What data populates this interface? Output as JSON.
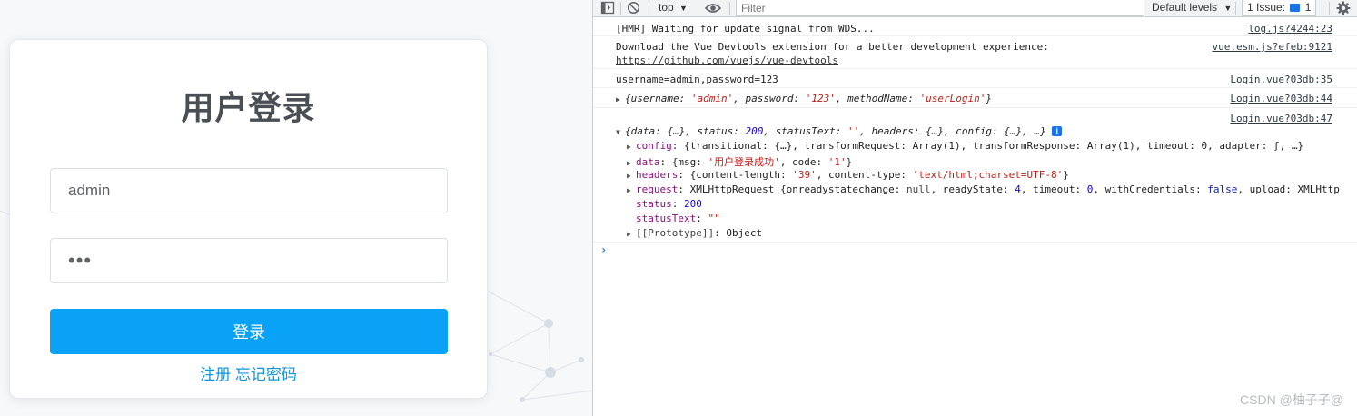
{
  "login": {
    "title": "用户登录",
    "username_value": "admin",
    "password_value": "•••",
    "submit_label": "登录",
    "register_link": "注册",
    "forgot_link": "忘记密码"
  },
  "devtools": {
    "toolbar": {
      "context": "top",
      "filter_placeholder": "Filter",
      "levels": "Default levels",
      "issues_label": "1 Issue:",
      "issues_count": "1"
    },
    "logs": [
      {
        "text": "[HMR] Waiting for update signal from WDS...",
        "source": "log.js?4244:23"
      },
      {
        "text": "Download the Vue Devtools extension for a better development experience:",
        "link": "https://github.com/vuejs/vue-devtools",
        "source": "vue.esm.js?efeb:9121"
      },
      {
        "text": "username=admin,password=123",
        "source": "Login.vue?03db:35"
      },
      {
        "source": "Login.vue?03db:44"
      },
      {
        "source": "Login.vue?03db:47"
      }
    ],
    "params_object": {
      "open": "{",
      "k1": "username",
      "v1": "'admin'",
      "k2": "password",
      "v2": "'123'",
      "k3": "methodName",
      "v3": "'userLogin'",
      "close": "}"
    },
    "response_summary": {
      "p1": "{data: {…}, status: ",
      "status": "200",
      "p2": ", statusText: ",
      "statusText": "''",
      "p3": ", headers: {…}, config: {…}, …}",
      "info": "i"
    },
    "response_props": {
      "config_key": "config",
      "config_val": "{transitional: {…}, transformRequest: Array(1), transformResponse: Array(1), timeout: 0, adapter: ƒ, …}",
      "data_key": "data",
      "data_p1": "{msg: ",
      "data_msg": "'用户登录成功'",
      "data_p2": ", code: ",
      "data_code": "'1'",
      "data_p3": "}",
      "headers_key": "headers",
      "headers_p1": "{content-length: ",
      "headers_len": "'39'",
      "headers_p2": ", content-type: ",
      "headers_type": "'text/html;charset=UTF-8'",
      "headers_p3": "}",
      "request_key": "request",
      "request_p1": "XMLHttpRequest {onreadystatechange: ",
      "request_null": "null",
      "request_p2": ", readyState: ",
      "request_rs": "4",
      "request_p3": ", timeout: ",
      "request_to": "0",
      "request_p4": ", withCredentials: ",
      "request_wc": "false",
      "request_p5": ", upload: XMLHttp",
      "status_key": "status",
      "status_val": "200",
      "statusText_key": "statusText",
      "statusText_val": "\"\"",
      "proto_key": "[[Prototype]]",
      "proto_val": "Object"
    },
    "prompt": "›"
  },
  "watermark": "CSDN @柚子子@",
  "colors": {
    "login_button": "#0aa2f7",
    "link": "#1296db",
    "string": "#c41a16",
    "number": "#1c00cf",
    "key": "#881280",
    "issues_accent": "#1a73e8"
  }
}
